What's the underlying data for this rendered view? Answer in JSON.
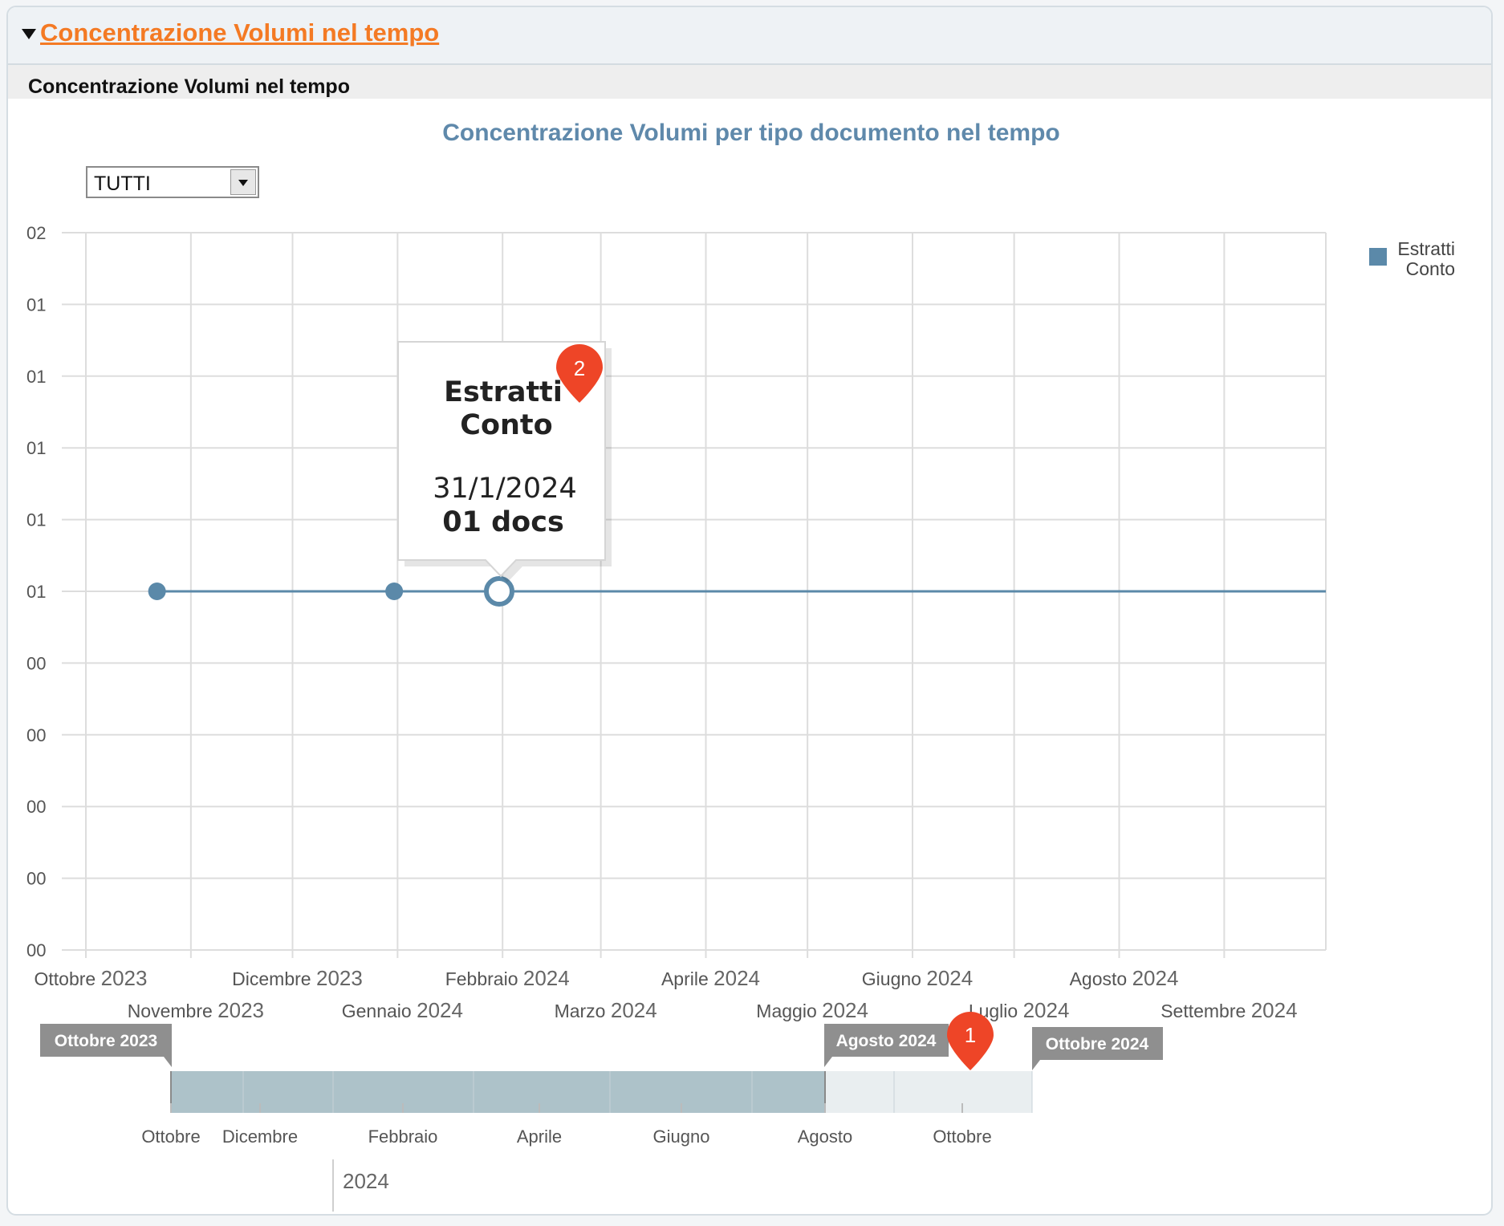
{
  "panel": {
    "header_title": "Concentrazione Volumi nel tempo",
    "subheader": "Concentrazione Volumi nel tempo"
  },
  "filter": {
    "selected": "TUTTI"
  },
  "legend": {
    "label_line1": "Estratti",
    "label_line2": "Conto",
    "color": "#5b89a9"
  },
  "tooltip": {
    "series_line1": "Estratti",
    "series_line2": "Conto",
    "date_part1": "31/1/",
    "date_part2": "2024",
    "value": "01 docs"
  },
  "badges": {
    "badge1": "1",
    "badge2": "2",
    "color": "#ee4527"
  },
  "chart_data": {
    "type": "line",
    "title": "Concentrazione Volumi per tipo documento nel tempo",
    "y_tick_labels": [
      "02",
      "01",
      "01",
      "01",
      "01",
      "01",
      "00",
      "00",
      "00",
      "00",
      "00"
    ],
    "y_tick_values": [
      2.0,
      1.8,
      1.6,
      1.4,
      1.2,
      1.0,
      0.8,
      0.6,
      0.4,
      0.2,
      0.0
    ],
    "ylim": [
      0,
      2
    ],
    "xlim": [
      "2023-10-01",
      "2024-10-01"
    ],
    "x_ticks": [
      {
        "date": "2023-10-01",
        "month": "Ottobre",
        "year": "2023",
        "row": 1
      },
      {
        "date": "2023-11-01",
        "month": "Novembre",
        "year": "2023",
        "row": 2
      },
      {
        "date": "2023-12-01",
        "month": "Dicembre",
        "year": "2023",
        "row": 1
      },
      {
        "date": "2024-01-01",
        "month": "Gennaio",
        "year": "2024",
        "row": 2
      },
      {
        "date": "2024-02-01",
        "month": "Febbraio",
        "year": "2024",
        "row": 1
      },
      {
        "date": "2024-03-01",
        "month": "Marzo",
        "year": "2024",
        "row": 2
      },
      {
        "date": "2024-04-01",
        "month": "Aprile",
        "year": "2024",
        "row": 1
      },
      {
        "date": "2024-05-01",
        "month": "Maggio",
        "year": "2024",
        "row": 2
      },
      {
        "date": "2024-06-01",
        "month": "Giugno",
        "year": "2024",
        "row": 1
      },
      {
        "date": "2024-07-01",
        "month": "Luglio",
        "year": "2024",
        "row": 2
      },
      {
        "date": "2024-08-01",
        "month": "Agosto",
        "year": "2024",
        "row": 1
      },
      {
        "date": "2024-09-01",
        "month": "Settembre",
        "year": "2024",
        "row": 2
      }
    ],
    "series": [
      {
        "name": "Estratti Conto",
        "color": "#5b89a9",
        "points": [
          {
            "date": "2023-10-22",
            "value": 1
          },
          {
            "date": "2023-12-31",
            "value": 1
          },
          {
            "date": "2024-01-31",
            "value": 1
          }
        ],
        "line_end": "2024-10-01"
      }
    ],
    "highlighted_point": "2024-01-31",
    "grid": true,
    "legend_position": "top-right"
  },
  "navigator": {
    "start_flag": "Ottobre 2023",
    "mid_flag": "Agosto 2024",
    "end_flag": "Ottobre 2024",
    "range_start": "2023-10-01",
    "range_end": "2024-08-01",
    "ticks": [
      "Ottobre",
      "Dicembre",
      "Febbraio",
      "Aprile",
      "Giugno",
      "Agosto",
      "Ottobre"
    ],
    "year_label": "2024"
  }
}
